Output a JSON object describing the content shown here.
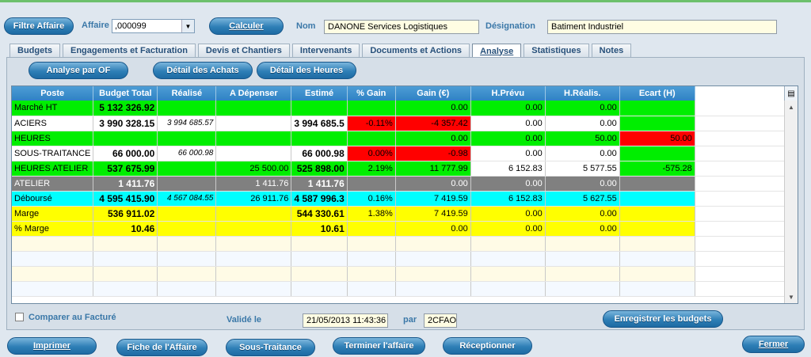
{
  "header": {
    "filtre_button": "Filtre Affaire",
    "affaire_label": "Affaire",
    "affaire_value": ",000099",
    "calculer_button": "Calculer",
    "nom_label": "Nom",
    "nom_value": "DANONE Services Logistiques",
    "designation_label": "Désignation",
    "designation_value": "Batiment Industriel"
  },
  "tabs": [
    {
      "label": "Budgets",
      "active": false
    },
    {
      "label": "Engagements et Facturation",
      "active": false
    },
    {
      "label": "Devis et Chantiers",
      "active": false
    },
    {
      "label": "Intervenants",
      "active": false
    },
    {
      "label": "Documents et Actions",
      "active": false
    },
    {
      "label": "Analyse",
      "active": true
    },
    {
      "label": "Statistiques",
      "active": false
    },
    {
      "label": "Notes",
      "active": false
    }
  ],
  "analysis_buttons": {
    "analyse_of": "Analyse par OF",
    "detail_achats": "Détail des Achats",
    "detail_heures": "Détail des Heures"
  },
  "grid": {
    "columns": [
      "Poste",
      "Budget Total",
      "Réalisé",
      "A Dépenser",
      "Estimé",
      "% Gain",
      "Gain (€)",
      "H.Prévu",
      "H.Réalis.",
      "Ecart (H)"
    ],
    "rows": [
      {
        "cells": [
          "Marché HT",
          "5 132 326.92",
          "",
          "",
          "",
          "",
          "0.00",
          "0.00",
          "0.00",
          ""
        ]
      },
      {
        "cells": [
          "ACIERS",
          "3 990 328.15",
          "3 994 685.57",
          "",
          "3 994 685.5",
          "-0.11%",
          "-4 357.42",
          "0.00",
          "0.00",
          ""
        ]
      },
      {
        "cells": [
          "HEURES",
          "",
          "",
          "",
          "",
          "",
          "0.00",
          "0.00",
          "50.00",
          "50.00"
        ]
      },
      {
        "cells": [
          "SOUS-TRAITANCE",
          "66 000.00",
          "66 000.98",
          "",
          "66 000.98",
          "0.00%",
          "-0.98",
          "0.00",
          "0.00",
          ""
        ]
      },
      {
        "cells": [
          "HEURES ATELIER",
          "537 675.99",
          "",
          "25 500.00",
          "525 898.00",
          "2.19%",
          "11 777.99",
          "6 152.83",
          "5 577.55",
          "-575.28"
        ]
      },
      {
        "cells": [
          "ATELIER",
          "1 411.76",
          "",
          "1 411.76",
          "1 411.76",
          "",
          "0.00",
          "0.00",
          "0.00",
          ""
        ]
      },
      {
        "cells": [
          "Déboursé",
          "4 595 415.90",
          "4 567 084.55",
          "26 911.76",
          "4 587 996.3",
          "0.16%",
          "7 419.59",
          "6 152.83",
          "5 627.55",
          ""
        ]
      },
      {
        "cells": [
          "Marge",
          "536 911.02",
          "",
          "",
          "544 330.61",
          "1.38%",
          "7 419.59",
          "0.00",
          "0.00",
          ""
        ]
      },
      {
        "cells": [
          "% Marge",
          "10.46",
          "",
          "",
          "10.61",
          "",
          "0.00",
          "0.00",
          "0.00",
          ""
        ]
      }
    ]
  },
  "footer_fields": {
    "comparer_label": "Comparer au Facturé",
    "valide_label": "Validé le",
    "valide_value": "21/05/2013 11:43:36",
    "par_label": "par",
    "par_value": "2CFAO",
    "enregistrer_button": "Enregistrer les budgets"
  },
  "bottom_buttons": {
    "imprimer": "Imprimer",
    "fiche": "Fiche de l'Affaire",
    "sous_traitance": "Sous-Traitance",
    "terminer": "Terminer l'affaire",
    "receptionner": "Réceptionner",
    "fermer": "Fermer"
  },
  "colors": {
    "green": "#00ee00",
    "red": "#ff0000",
    "cyan": "#00ffff",
    "yellow": "#ffff00",
    "gray": "#808080",
    "header_blue": "#2f82c4"
  }
}
